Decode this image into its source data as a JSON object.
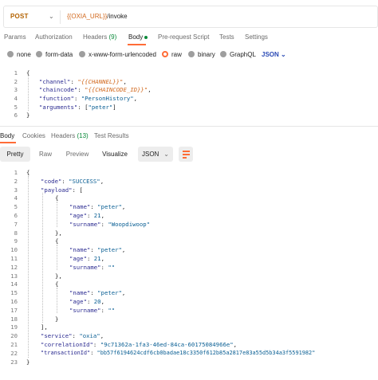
{
  "request": {
    "method": "POST",
    "url_variable": "{{OXIA_URL}}",
    "url_path": "/invoke",
    "tabs": [
      {
        "label": "Params"
      },
      {
        "label": "Authorization"
      },
      {
        "label": "Headers",
        "count": "(9)"
      },
      {
        "label": "Body"
      },
      {
        "label": "Pre-request Script"
      },
      {
        "label": "Tests"
      },
      {
        "label": "Settings"
      }
    ],
    "body_options": [
      "none",
      "form-data",
      "x-www-form-urlencoded",
      "raw",
      "binary",
      "GraphQL"
    ],
    "body_selected": "raw",
    "language": "JSON",
    "line_numbers": [
      "1",
      "2",
      "3",
      "4",
      "5",
      "6"
    ],
    "code": {
      "l1": "{",
      "l2_key": "\"channel\"",
      "l2_val": "\"{{CHANNEL}}\"",
      "l3_key": "\"chaincode\"",
      "l3_val": "\"{{CHAINCODE_ID}}\"",
      "l4_key": "\"function\"",
      "l4_val": "\"PersonHistory\"",
      "l5_key": "\"arguments\"",
      "l5_val": "\"peter\"",
      "l6": "}"
    }
  },
  "response": {
    "tabs": [
      {
        "label": "Body"
      },
      {
        "label": "Cookies"
      },
      {
        "label": "Headers",
        "count": "(13)"
      },
      {
        "label": "Test Results"
      }
    ],
    "view_modes": [
      "Pretty",
      "Raw",
      "Preview",
      "Visualize"
    ],
    "format": "JSON",
    "line_numbers": [
      "1",
      "2",
      "3",
      "4",
      "5",
      "6",
      "7",
      "8",
      "9",
      "10",
      "11",
      "12",
      "13",
      "14",
      "15",
      "16",
      "17",
      "18",
      "19",
      "20",
      "21",
      "22",
      "23"
    ],
    "body": {
      "code": "\"SUCCESS\"",
      "payload": [
        {
          "name": "\"peter\"",
          "age": "21",
          "surname": "\"Woopdiwoop\""
        },
        {
          "name": "\"peter\"",
          "age": "21",
          "surname": "\"\""
        },
        {
          "name": "\"peter\"",
          "age": "20",
          "surname": "\"\""
        }
      ],
      "service": "\"oxia\"",
      "correlationId": "\"9c71362a-1fa3-46ed-84ca-60175084966e\"",
      "transactionId": "\"bb57f6194624cdf6cb0badae18c3350f612b85a2817e83a55d5b34a3f5591982\""
    },
    "keys": {
      "code": "\"code\"",
      "payload": "\"payload\"",
      "name": "\"name\"",
      "age": "\"age\"",
      "surname": "\"surname\"",
      "service": "\"service\"",
      "correlationId": "\"correlationId\"",
      "transactionId": "\"transactionId\""
    }
  },
  "colors": {
    "accent": "#ff6c37",
    "method": "#b36200",
    "variable": "#d2691e",
    "count": "#0a8a3a",
    "json_link": "#2a4ab5"
  }
}
